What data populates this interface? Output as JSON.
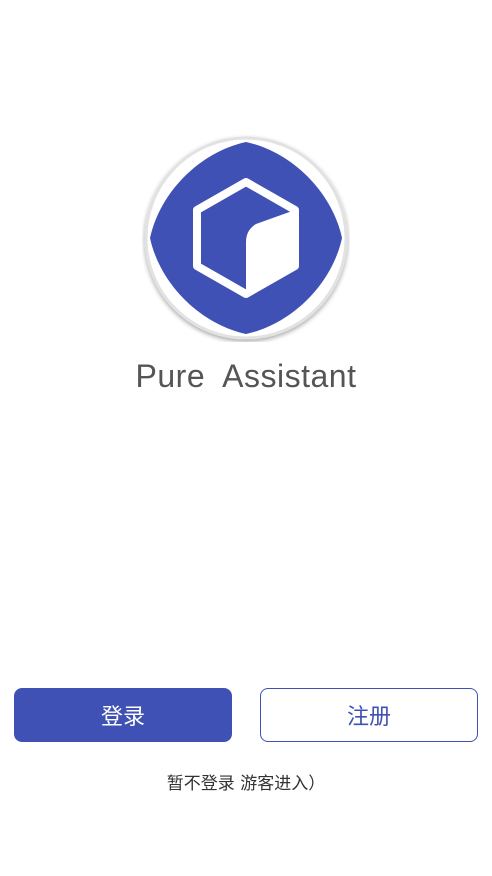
{
  "app": {
    "title": "Pure  Assistant",
    "logo_icon": "cube-logo-icon"
  },
  "actions": {
    "login_label": "登录",
    "register_label": "注册",
    "guest_label": "暂不登录 游客进入）"
  },
  "colors": {
    "brand": "#3f51b5",
    "title_text": "#555555",
    "guest_text": "#333333",
    "background": "#ffffff"
  }
}
